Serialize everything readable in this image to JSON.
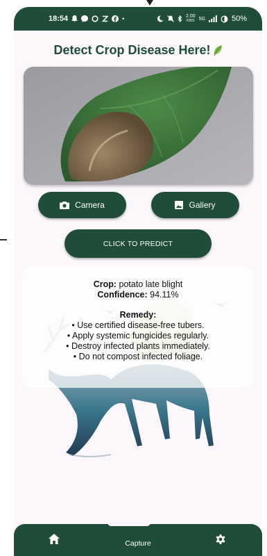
{
  "status_bar": {
    "time": "18:54",
    "left_icons": [
      "notification-icon",
      "message-icon",
      "circle-icon",
      "z-icon",
      "facebook-icon"
    ],
    "dot": "•",
    "speed": "2.00",
    "speed_unit": "KB/S",
    "network": "5G",
    "battery": "50%"
  },
  "header": {
    "title": "Detect Crop Disease Here!",
    "icon": "leaf-icon"
  },
  "image_preview": {
    "subject": "potato-leaf-photo"
  },
  "buttons": {
    "camera_label": "Camera",
    "gallery_label": "Gallery",
    "predict_label": "CLICK TO PREDICT"
  },
  "result": {
    "crop_label": "Crop:",
    "crop_value": "potato late blight",
    "confidence_label": "Confidence:",
    "confidence_value": "94.11%",
    "remedy_title": "Remedy:",
    "remedies": [
      "• Use certified disease-free tubers.",
      "• Apply systemic fungicides regularly.",
      "• Destroy infected plants immediately.",
      "• Do not compost infected foliage."
    ]
  },
  "bottom_nav": {
    "home_icon": "home-icon",
    "capture_label": "Capture",
    "settings_icon": "settings-icon"
  },
  "colors": {
    "primary": "#1f4d3a",
    "background": "#fbf7fb"
  }
}
